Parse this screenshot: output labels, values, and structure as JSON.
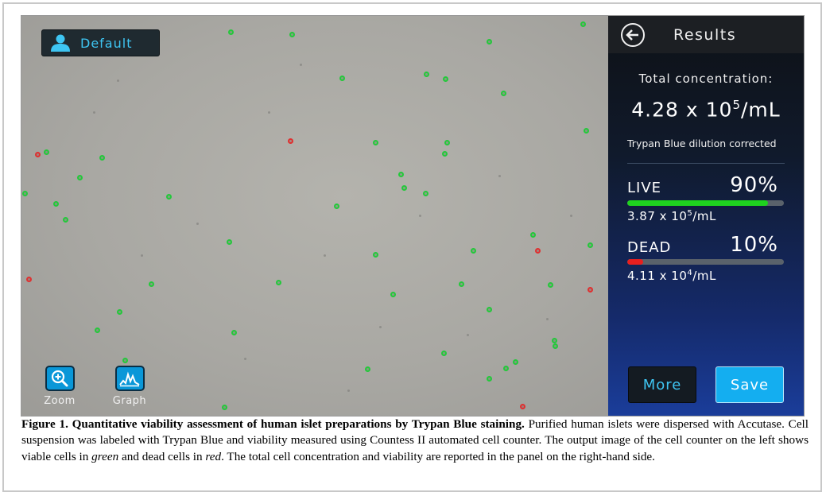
{
  "profile": {
    "label": "Default",
    "icon": "user-icon"
  },
  "tools": [
    {
      "label": "Zoom",
      "icon": "zoom-in-icon"
    },
    {
      "label": "Graph",
      "icon": "graph-icon"
    }
  ],
  "results": {
    "title": "Results",
    "back_icon": "back-arrow-icon",
    "total_label": "Total concentration:",
    "total_value": {
      "mantissa": "4.28 x 10",
      "exponent": "5",
      "unit": "/mL"
    },
    "dilution_note": "Trypan Blue dilution corrected",
    "live": {
      "label": "LIVE",
      "percent_text": "90%",
      "percent": 90,
      "mantissa": "3.87 x 10",
      "exponent": "5",
      "unit": "/mL",
      "color": "#1fd21f"
    },
    "dead": {
      "label": "DEAD",
      "percent_text": "10%",
      "percent": 10,
      "mantissa": "4.11 x 10",
      "exponent": "4",
      "unit": "/mL",
      "color": "#e81f1f"
    },
    "more_label": "More",
    "save_label": "Save"
  },
  "colors": {
    "accent": "#3ec5f2",
    "live_cell": "#23c93a",
    "dead_cell": "#e03030",
    "save_button": "#14aef0"
  },
  "caption": {
    "bold": "Figure 1. Quantitative viability assessment of human islet preparations by Trypan Blue staining.",
    "text1": " Purified human islets were dispersed with Accutase. Cell suspension was labeled with Trypan Blue and viability measured using Countess II automated cell counter. The output image of the cell counter on the left shows viable cells in ",
    "italic1": "green",
    "text2": " and dead cells in ",
    "italic2": "red",
    "text3": ". The total cell concentration and viability are reported in the panel on the right-hand side."
  }
}
